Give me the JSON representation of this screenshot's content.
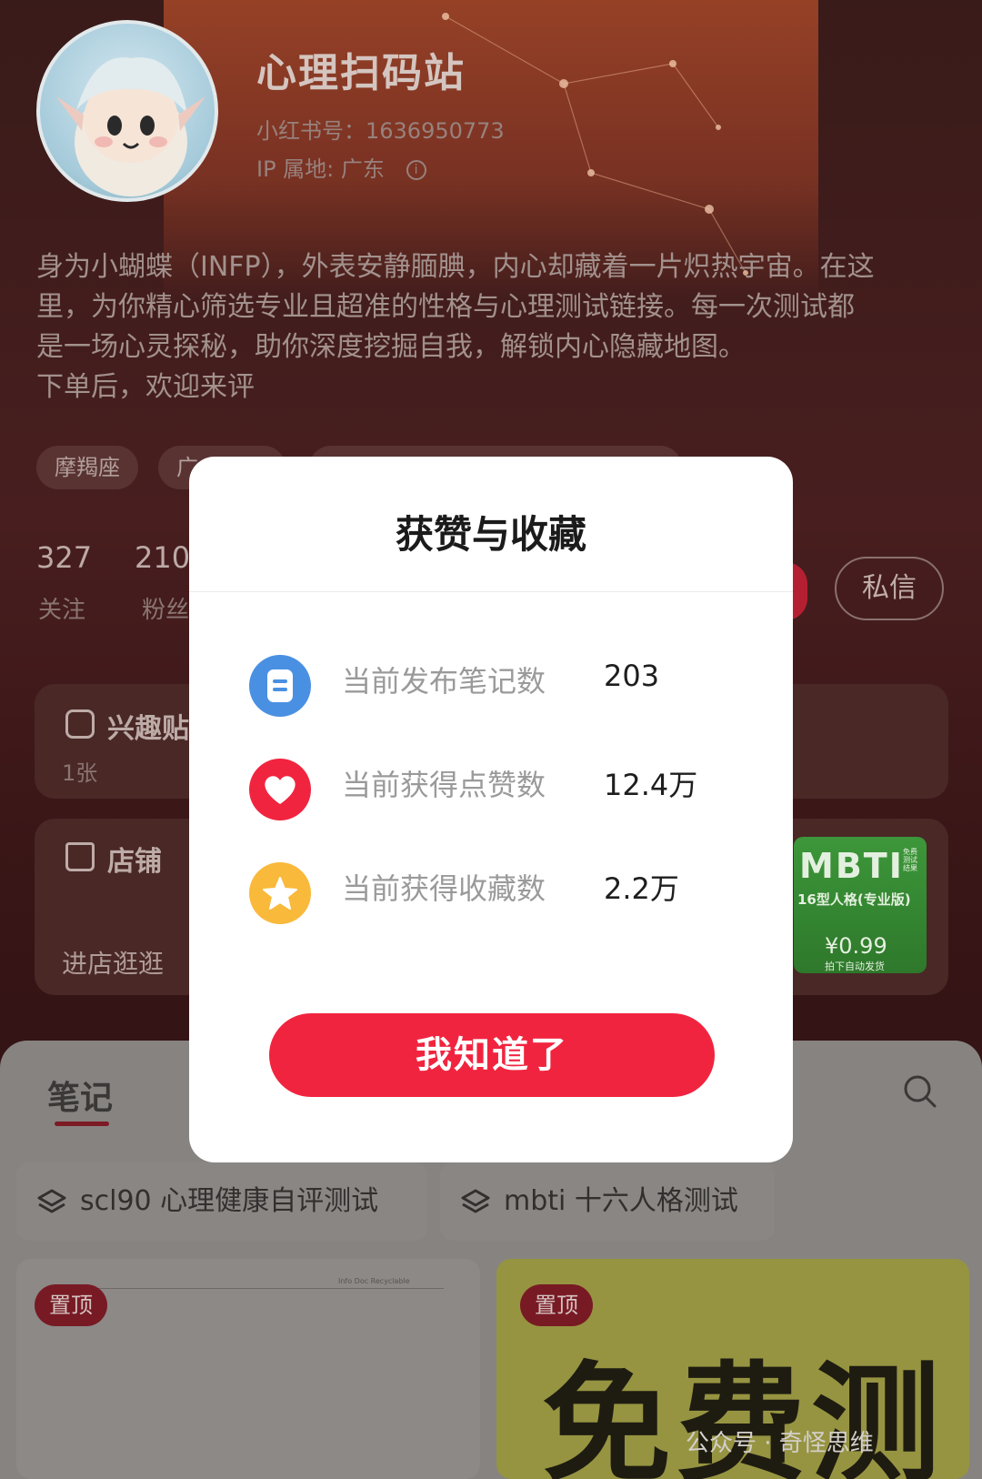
{
  "profile": {
    "name": "心理扫码站",
    "account_id": "小红书号：1636950773",
    "ip_location": "IP 属地: 广东",
    "bio_lines": [
      "身为小蝴蝶（INFP），外表安静腼腆，内心却藏着一片炽热宇宙。在这",
      "里，为你精心筛选专业且超准的性格与心理测试链接。每一次测试都",
      "是一场心灵探秘，助你深度挖掘自我，解锁内心隐藏地图。",
      "下单后，欢迎来评"
    ],
    "tags": [
      "摩羯座",
      "广"
    ]
  },
  "stats": {
    "following_count": "327",
    "following_label": "关注",
    "followers_count": "210",
    "followers_label": "粉丝"
  },
  "actions": {
    "message_label": "私信"
  },
  "interest_card": {
    "title": "兴趣贴",
    "sub": "1张"
  },
  "shop_card": {
    "title": "店铺",
    "sub": "进店逛逛",
    "thumb_title": "MBTI",
    "thumb_badge": "免费测试结果",
    "thumb_sub": "16型人格(专业版)",
    "thumb_price": "¥0.99",
    "thumb_note": "拍下自动发货"
  },
  "sheet": {
    "tab_label": "笔记",
    "collections": [
      "scl90 心理健康自评测试",
      "mbti 十六人格测试"
    ],
    "pin_label": "置顶",
    "free_text": "免费测",
    "doc_header": "Info Doc  Recyclable"
  },
  "watermark": "公众号 · 奇怪思维",
  "modal": {
    "title": "获赞与收藏",
    "rows": [
      {
        "icon": "note-icon",
        "label": "当前发布笔记数",
        "value": "203",
        "color": "#4a90e2"
      },
      {
        "icon": "heart-icon",
        "label": "当前获得点赞数",
        "value": "12.4万",
        "color": "#f1243f"
      },
      {
        "icon": "star-icon",
        "label": "当前获得收藏数",
        "value": "2.2万",
        "color": "#f9b93a"
      }
    ],
    "confirm_label": "我知道了"
  }
}
